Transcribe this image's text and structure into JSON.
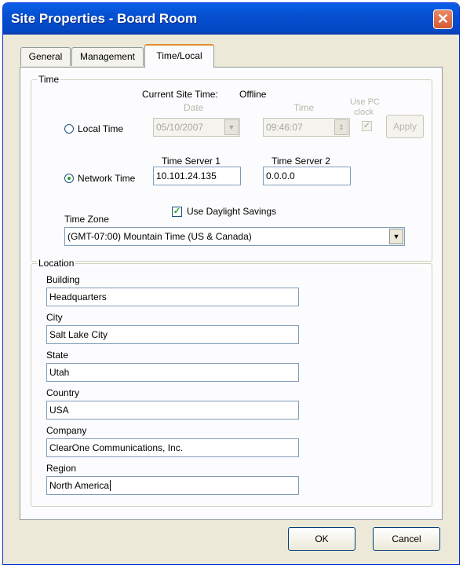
{
  "window": {
    "title": "Site Properties - Board Room",
    "close_glyph": "✕"
  },
  "tabs": [
    {
      "label": "General"
    },
    {
      "label": "Management"
    },
    {
      "label": "Time/Local",
      "active": true
    }
  ],
  "time_group": {
    "label": "Time",
    "current_site_time_label": "Current Site Time:",
    "current_site_time_value": "Offline",
    "date_label": "Date",
    "time_label": "Time",
    "use_pc_clock_label_1": "Use PC",
    "use_pc_clock_label_2": "clock",
    "local_time_label": "Local Time",
    "date_value": "05/10/2007",
    "time_value": "09:46:07",
    "apply_label": "Apply",
    "network_time_label": "Network Time",
    "time_server_1_label": "Time Server 1",
    "time_server_1_value": "10.101.24.135",
    "time_server_2_label": "Time Server 2",
    "time_server_2_value": "0.0.0.0",
    "daylight_savings_label": "Use Daylight Savings",
    "daylight_savings_checked": true,
    "time_zone_label": "Time Zone",
    "time_zone_value": "(GMT-07:00) Mountain Time (US & Canada)",
    "selected_mode": "network"
  },
  "location_group": {
    "label": "Location",
    "fields": [
      {
        "label": "Building",
        "value": "Headquarters"
      },
      {
        "label": "City",
        "value": "Salt Lake City"
      },
      {
        "label": "State",
        "value": "Utah"
      },
      {
        "label": "Country",
        "value": "USA"
      },
      {
        "label": "Company",
        "value": "ClearOne Communications, Inc."
      },
      {
        "label": "Region",
        "value": "North America"
      }
    ]
  },
  "footer": {
    "ok_label": "OK",
    "cancel_label": "Cancel"
  },
  "icons": {
    "dropdown": "▼",
    "checkmark": "✓",
    "spinner": "⇕"
  }
}
